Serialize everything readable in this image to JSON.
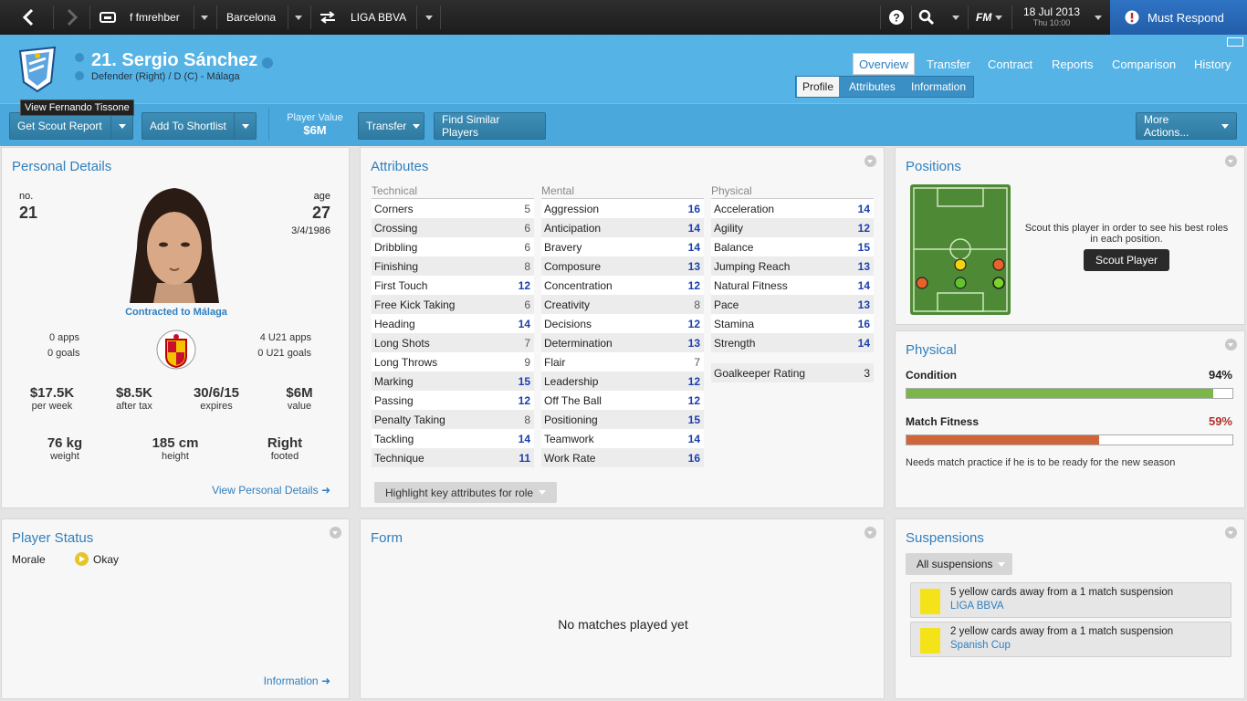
{
  "topnav": {
    "manager": "f fmrehber",
    "club": "Barcelona",
    "league": "LIGA BBVA",
    "fm_label": "FM",
    "date": "18 Jul 2013",
    "time": "Thu 10:00",
    "must_respond": "Must Respond"
  },
  "player": {
    "title": "21. Sergio Sánchez",
    "subtitle": "Defender (Right) / D (C) - Málaga",
    "tooltip": "View Fernando Tissone"
  },
  "tabs": {
    "main": [
      "Overview",
      "Transfer",
      "Contract",
      "Reports",
      "Comparison",
      "History"
    ],
    "sub": [
      "Profile",
      "Attributes",
      "Information"
    ]
  },
  "actions": {
    "scout": "Get Scout Report",
    "shortlist": "Add To Shortlist",
    "value_label": "Player Value",
    "value": "$6M",
    "transfer": "Transfer",
    "similar": "Find Similar Players",
    "more": "More Actions..."
  },
  "personal": {
    "title": "Personal Details",
    "no_label": "no.",
    "no": "21",
    "age_label": "age",
    "age": "27",
    "dob": "3/4/1986",
    "contract": "Contracted to Málaga",
    "apps": "0 apps",
    "goals": "0 goals",
    "u21_apps": "4 U21 apps",
    "u21_goals": "0 U21 goals",
    "wage": "$17.5K",
    "wage_label": "per week",
    "after_tax": "$8.5K",
    "after_tax_label": "after tax",
    "expires": "30/6/15",
    "expires_label": "expires",
    "value": "$6M",
    "value_label": "value",
    "weight": "76 kg",
    "weight_label": "weight",
    "height": "185 cm",
    "height_label": "height",
    "foot": "Right",
    "foot_label": "footed",
    "link": "View Personal Details"
  },
  "attributes": {
    "title": "Attributes",
    "highlight": "Highlight key attributes for role",
    "columns": [
      {
        "head": "Technical",
        "rows": [
          [
            "Corners",
            "5"
          ],
          [
            "Crossing",
            "6"
          ],
          [
            "Dribbling",
            "6"
          ],
          [
            "Finishing",
            "8"
          ],
          [
            "First Touch",
            "12"
          ],
          [
            "Free Kick Taking",
            "6"
          ],
          [
            "Heading",
            "14"
          ],
          [
            "Long Shots",
            "7"
          ],
          [
            "Long Throws",
            "9"
          ],
          [
            "Marking",
            "15"
          ],
          [
            "Passing",
            "12"
          ],
          [
            "Penalty Taking",
            "8"
          ],
          [
            "Tackling",
            "14"
          ],
          [
            "Technique",
            "11"
          ]
        ]
      },
      {
        "head": "Mental",
        "rows": [
          [
            "Aggression",
            "16"
          ],
          [
            "Anticipation",
            "14"
          ],
          [
            "Bravery",
            "14"
          ],
          [
            "Composure",
            "13"
          ],
          [
            "Concentration",
            "12"
          ],
          [
            "Creativity",
            "8"
          ],
          [
            "Decisions",
            "12"
          ],
          [
            "Determination",
            "13"
          ],
          [
            "Flair",
            "7"
          ],
          [
            "Leadership",
            "12"
          ],
          [
            "Off The Ball",
            "12"
          ],
          [
            "Positioning",
            "15"
          ],
          [
            "Teamwork",
            "14"
          ],
          [
            "Work Rate",
            "16"
          ]
        ]
      },
      {
        "head": "Physical",
        "rows": [
          [
            "Acceleration",
            "14"
          ],
          [
            "Agility",
            "12"
          ],
          [
            "Balance",
            "15"
          ],
          [
            "Jumping Reach",
            "13"
          ],
          [
            "Natural Fitness",
            "14"
          ],
          [
            "Pace",
            "13"
          ],
          [
            "Stamina",
            "16"
          ],
          [
            "Strength",
            "14"
          ]
        ]
      }
    ],
    "gk_label": "Goalkeeper Rating",
    "gk_value": "3"
  },
  "positions": {
    "title": "Positions",
    "note": "Scout this player in order to see his best roles in each position.",
    "button": "Scout Player"
  },
  "physical": {
    "title": "Physical",
    "condition_label": "Condition",
    "condition": "94%",
    "condition_value": 0.94,
    "fitness_label": "Match Fitness",
    "fitness": "59%",
    "fitness_value": 0.59,
    "note": "Needs match practice if he is to be ready for the new season",
    "colors": {
      "condition": "#7ab648",
      "fitness": "#d0653a",
      "fitness_text": "#b0302a"
    }
  },
  "status": {
    "title": "Player Status",
    "morale_label": "Morale",
    "morale": "Okay",
    "link": "Information"
  },
  "form": {
    "title": "Form",
    "empty": "No matches played yet"
  },
  "suspensions": {
    "title": "Suspensions",
    "filter": "All suspensions",
    "items": [
      {
        "text": "5 yellow cards away from a 1 match suspension",
        "comp": "LIGA BBVA"
      },
      {
        "text": "2 yellow cards away from a 1 match suspension",
        "comp": "Spanish Cup"
      }
    ]
  }
}
